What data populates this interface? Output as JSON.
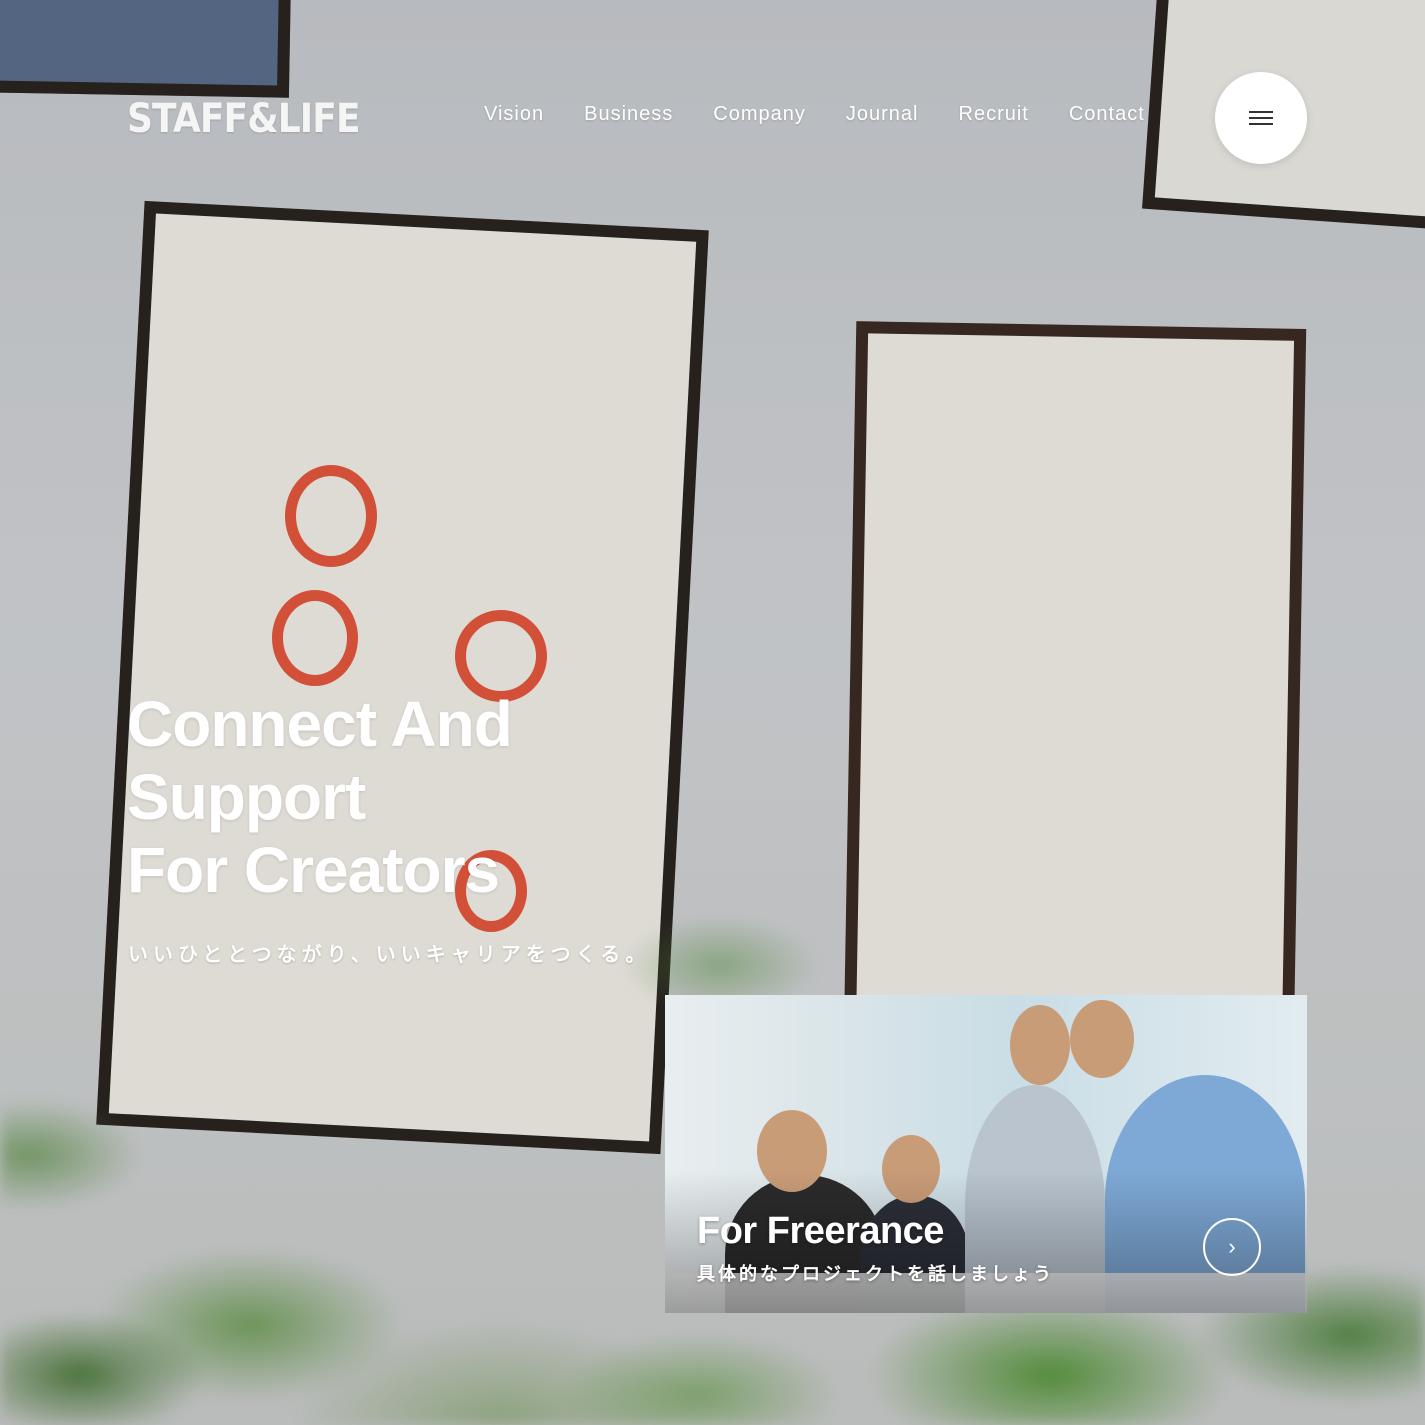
{
  "header": {
    "logo": "STAFF&LIFE",
    "nav": [
      "Vision",
      "Business",
      "Company",
      "Journal",
      "Recruit",
      "Contact"
    ],
    "menu_icon": "hamburger-menu-icon"
  },
  "hero": {
    "title_lines": [
      "Connect And",
      "Support",
      "For Creators"
    ],
    "subtitle": "いいひととつながり、いいキャリアをつくる。"
  },
  "card": {
    "title": "For Freerance",
    "subtitle": "具体的なプロジェクトを話しましょう",
    "arrow_icon": "chevron-right-icon"
  },
  "colors": {
    "text_on_photo": "#ffffff",
    "menu_button_bg": "#ffffff"
  }
}
